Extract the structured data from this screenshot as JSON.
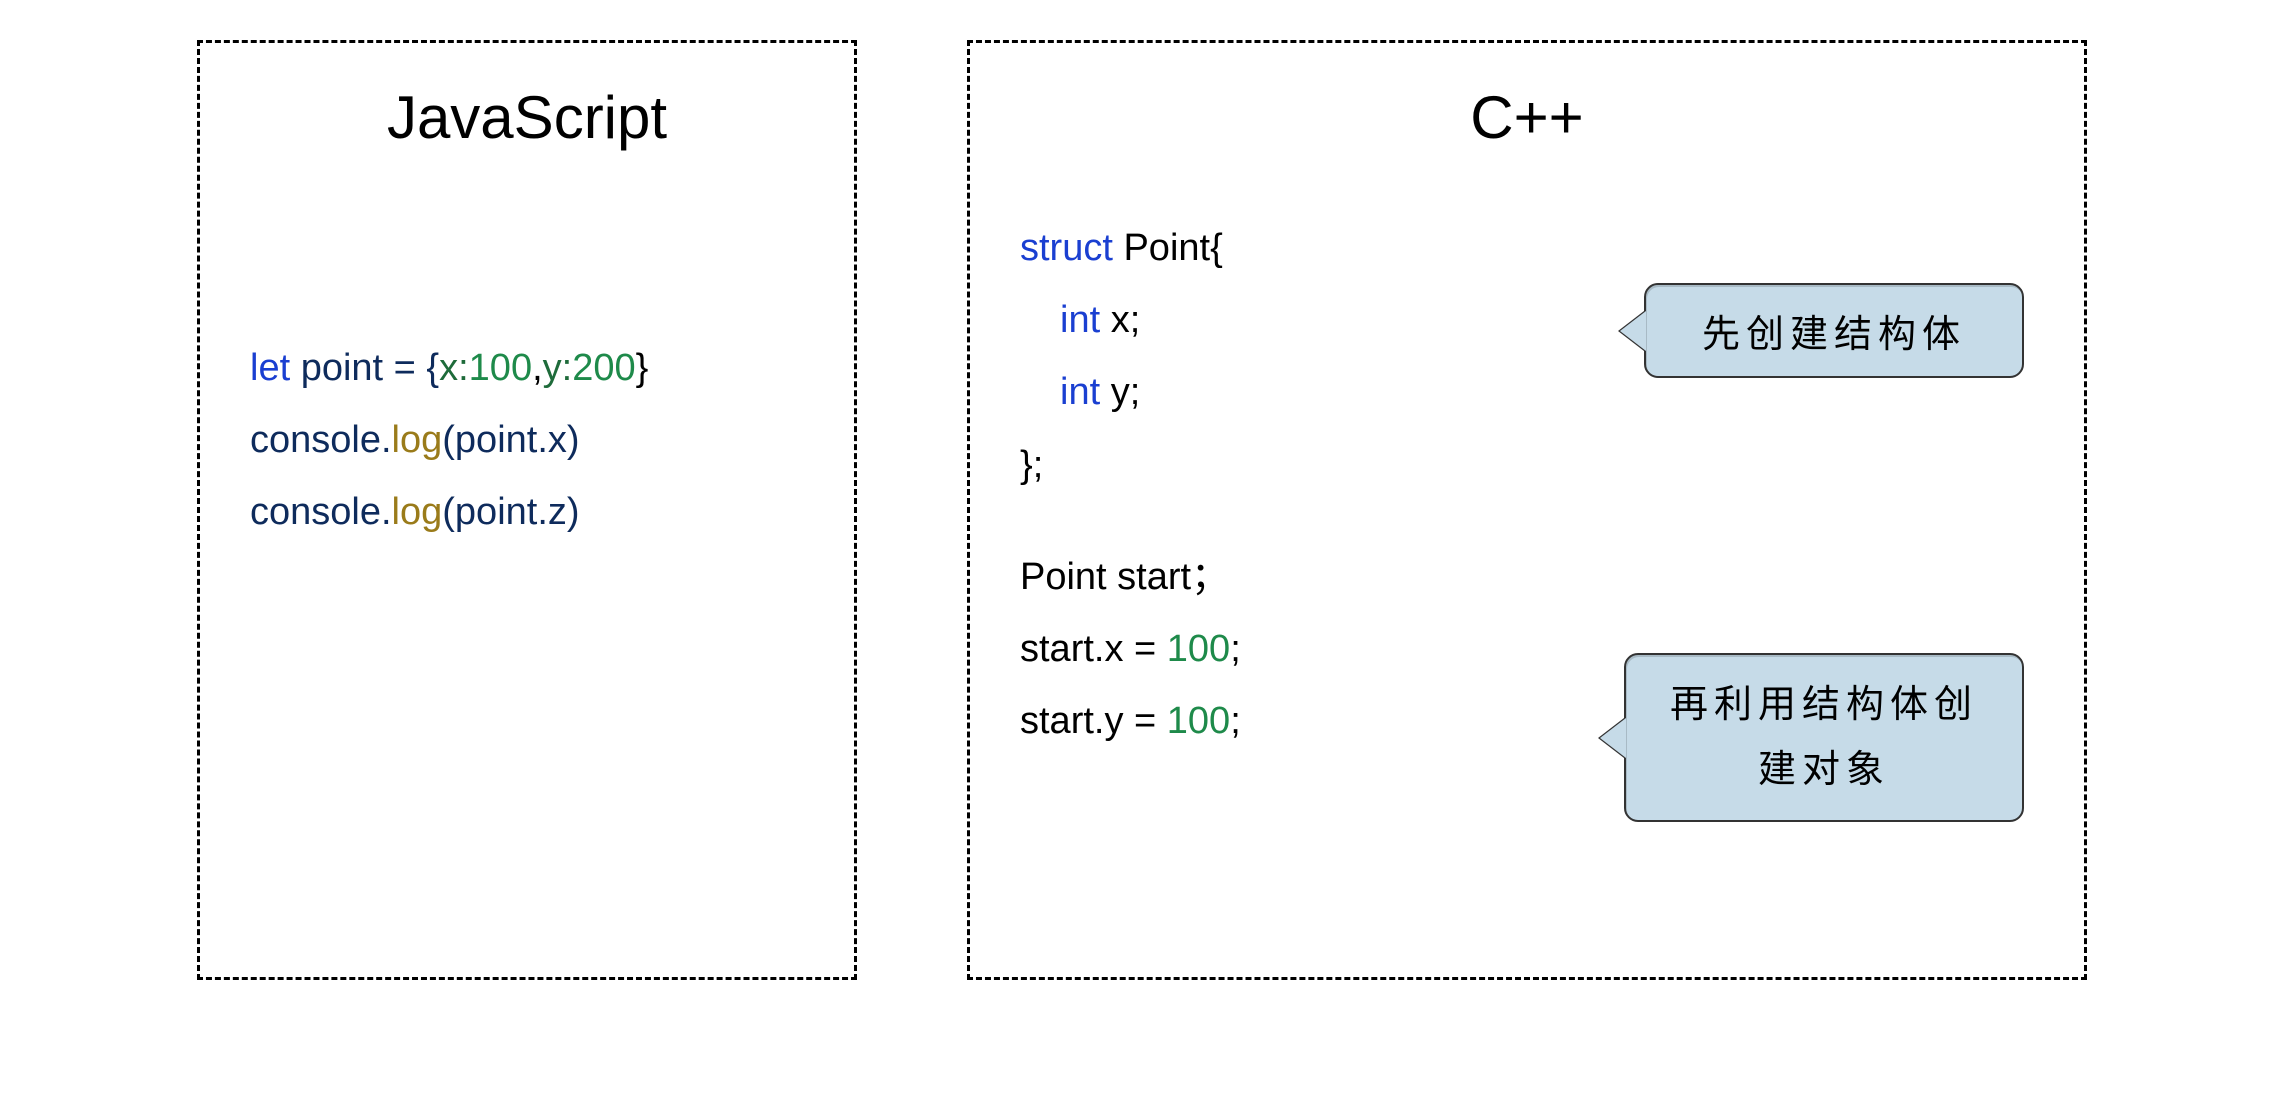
{
  "js": {
    "title": "JavaScript",
    "line1": {
      "kw": "let",
      "name": " point = {",
      "k1": "x:",
      "v1": "100",
      "sep": ",",
      "k2": "y:",
      "v2": "200",
      "end": "}"
    },
    "line2": {
      "obj": "console.",
      "fn": "log",
      "args": "(point.x)"
    },
    "line3": {
      "obj": "console.",
      "fn": "log",
      "args": "(point.z)"
    }
  },
  "cpp": {
    "title": "C++",
    "struct": {
      "kw": "struct",
      "name": " Point{",
      "f1kw": "int",
      "f1nm": " x;",
      "f2kw": "int",
      "f2nm": " y;",
      "end": "};"
    },
    "usage": {
      "decl": "Point start；",
      "a1l": "start.x = ",
      "a1v": "100",
      "a1e": ";",
      "a2l": "start.y = ",
      "a2v": "100",
      "a2e": ";"
    },
    "callout1": "先创建结构体",
    "callout2": "再利用结构体创建对象"
  }
}
